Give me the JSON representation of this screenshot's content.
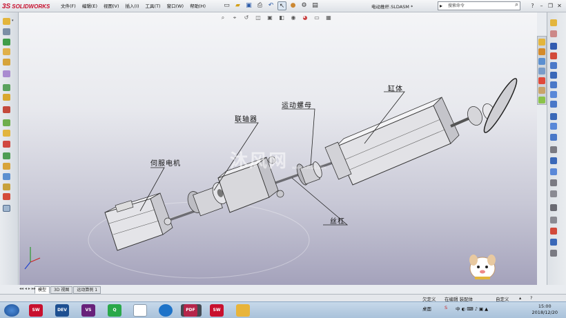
{
  "app": {
    "brand": "SOLIDWORKS",
    "document_title": "电动推杆.SLDASM *"
  },
  "menu": [
    {
      "label": "文件(F)"
    },
    {
      "label": "编辑(E)"
    },
    {
      "label": "视图(V)"
    },
    {
      "label": "插入(I)"
    },
    {
      "label": "工具(T)"
    },
    {
      "label": "窗口(W)"
    },
    {
      "label": "帮助(H)"
    }
  ],
  "search": {
    "placeholder": "搜索命令"
  },
  "callouts": {
    "servo_motor": "伺服电机",
    "coupling": "联轴器",
    "moving_nut": "运动螺母",
    "cylinder": "缸体",
    "lead_screw": "丝杠"
  },
  "watermark": {
    "text": "沐风网",
    "sub": "www.mfcad.com"
  },
  "tabs": [
    {
      "label": "模型",
      "active": true
    },
    {
      "label": "3D 视图",
      "active": false
    },
    {
      "label": "运动算例 1",
      "active": false
    }
  ],
  "status": {
    "underdefined": "欠定义",
    "editing": "在编辑 装配体",
    "custom": "自定义"
  },
  "taskbar": {
    "apps": [
      {
        "name": "solidworks-2015",
        "label": "SW",
        "color": "#c8102e"
      },
      {
        "name": "dev",
        "label": "DEV",
        "color": "#1d4f91"
      },
      {
        "name": "visual-studio",
        "label": "VS",
        "color": "#68217a"
      },
      {
        "name": "qq",
        "label": "Q",
        "color": "#2aa84a"
      },
      {
        "name": "app-white",
        "label": "",
        "color": "#ffffff"
      },
      {
        "name": "browser",
        "label": "",
        "color": "#1e73c8"
      },
      {
        "name": "app-gray",
        "label": "",
        "color": "#444a52"
      },
      {
        "name": "pdf-editor",
        "label": "PDF",
        "color": "#b5264b"
      },
      {
        "name": "solidworks-2016",
        "label": "SW",
        "color": "#c8102e"
      },
      {
        "name": "file-explorer",
        "label": "",
        "color": "#e8b43a"
      }
    ],
    "tray_label": "桌面",
    "time": "15:00",
    "date": "2018/12/20"
  },
  "colors": {
    "viewport_top": "#f4f5f7",
    "viewport_bottom": "#a4a2bb",
    "brand_red": "#c8102e"
  }
}
